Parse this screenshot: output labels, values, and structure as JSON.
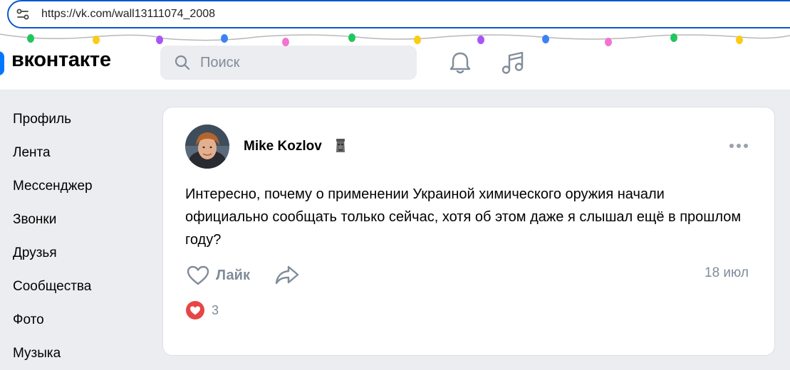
{
  "browser": {
    "url": "https://vk.com/wall13111074_2008",
    "site_icon": "site-settings-icon"
  },
  "header": {
    "logo_text": "вконтакте",
    "search_placeholder": "Поиск",
    "icons": [
      "bell-icon",
      "music-icon"
    ],
    "brand_color": "#0077ff"
  },
  "sidebar": {
    "items": [
      {
        "label": "Профиль"
      },
      {
        "label": "Лента"
      },
      {
        "label": "Мессенджер"
      },
      {
        "label": "Звонки"
      },
      {
        "label": "Друзья"
      },
      {
        "label": "Сообщества"
      },
      {
        "label": "Фото"
      },
      {
        "label": "Музыка"
      }
    ]
  },
  "post": {
    "author": "Mike Kozlov",
    "author_emoji": "moai-emoji",
    "text": "Интересно, почему о применении Украиной химического оружия начали официально сообщать только сейчас, хотя об этом даже я слышал ещё в прошлом году?",
    "like_label": "Лайк",
    "date": "18 июл",
    "reactions_count": "3",
    "reaction_color": "#e64646"
  }
}
